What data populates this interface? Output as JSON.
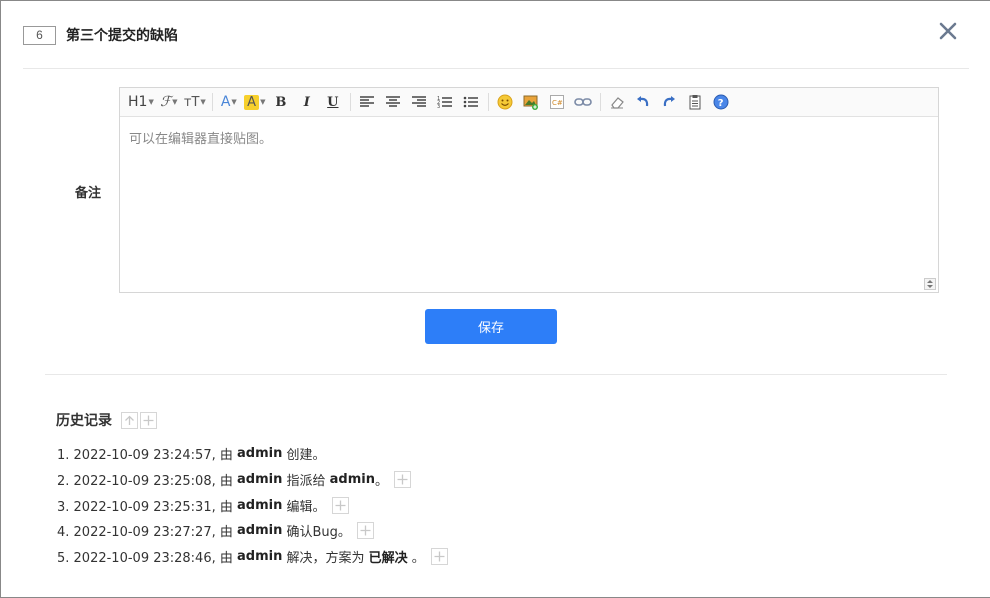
{
  "header": {
    "bug_id": "6",
    "title": "第三个提交的缺陷"
  },
  "form": {
    "remark_label": "备注",
    "editor": {
      "placeholder": "可以在编辑器直接贴图。",
      "toolbar": [
        {
          "name": "heading",
          "label": "H1",
          "dropdown": true
        },
        {
          "name": "font-family",
          "label": "ℱ",
          "dropdown": true
        },
        {
          "name": "font-size",
          "label": "ᴛT",
          "dropdown": true
        },
        {
          "name": "font-color",
          "label": "A",
          "dropdown": true
        },
        {
          "name": "background-color",
          "label": "A",
          "dropdown": true
        },
        {
          "name": "bold",
          "label": "B"
        },
        {
          "name": "italic",
          "label": "I"
        },
        {
          "name": "underline",
          "label": "U"
        }
      ]
    },
    "save_label": "保存"
  },
  "history": {
    "title": "历史记录",
    "items": [
      {
        "prefix": "1. 2022-10-09 23:24:57, 由 ",
        "actor": "admin",
        "action": " 创建。",
        "expandable": false
      },
      {
        "prefix": "2. 2022-10-09 23:25:08, 由 ",
        "actor": "admin",
        "action": " 指派给 ",
        "target": "admin",
        "suffix": "。",
        "expandable": true
      },
      {
        "prefix": "3. 2022-10-09 23:25:31, 由 ",
        "actor": "admin",
        "action": " 编辑。",
        "expandable": true
      },
      {
        "prefix": "4. 2022-10-09 23:27:27, 由 ",
        "actor": "admin",
        "action": " 确认Bug。",
        "expandable": true
      },
      {
        "prefix": "5. 2022-10-09 23:28:46, 由 ",
        "actor": "admin",
        "action": " 解决，方案为 ",
        "target": "已解决",
        "suffix": " 。",
        "expandable": true
      }
    ]
  },
  "colors": {
    "primary": "#2d7ef8",
    "border": "#d6d6d6"
  }
}
